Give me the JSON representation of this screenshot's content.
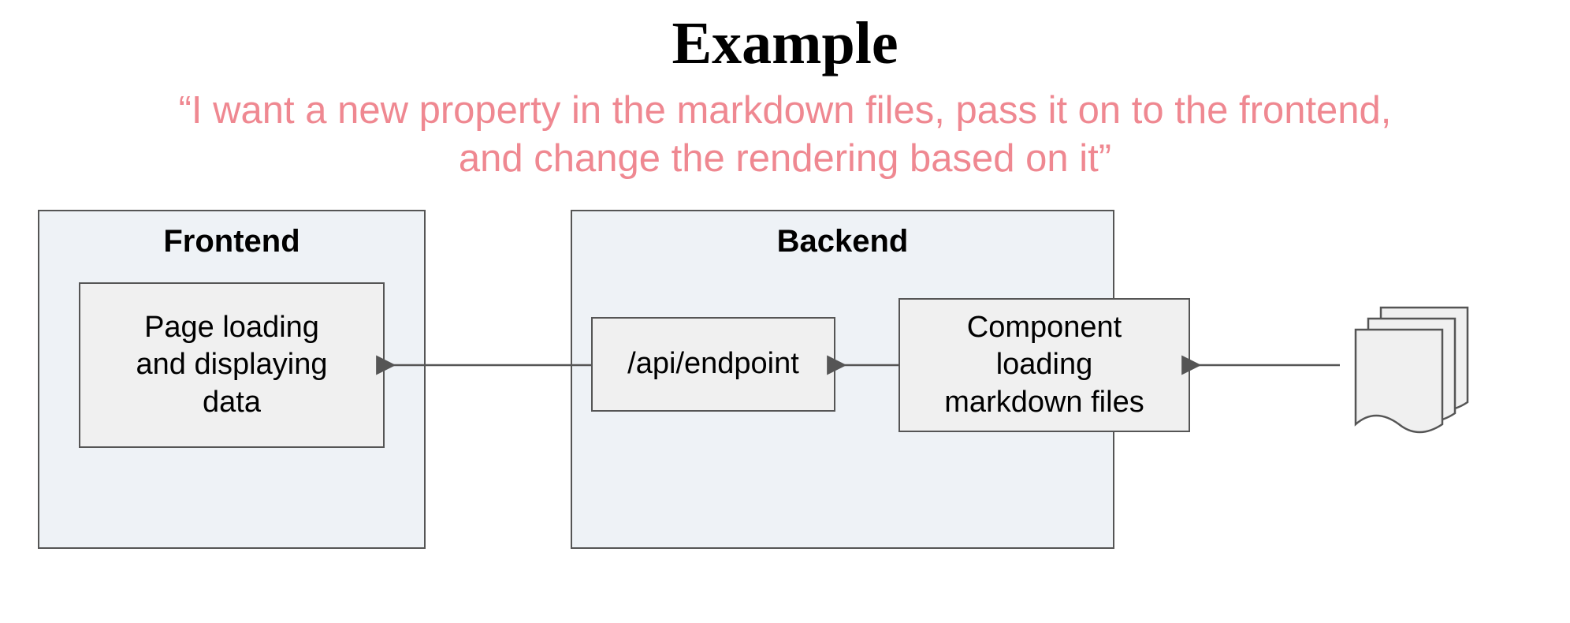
{
  "title": "Example",
  "subtitle_line1": "“I want a new property in the markdown files, pass it on to the frontend,",
  "subtitle_line2": "and change the rendering based on it”",
  "groups": {
    "frontend": {
      "label": "Frontend"
    },
    "backend": {
      "label": "Backend"
    }
  },
  "nodes": {
    "page": {
      "text": "Page loading\nand displaying\ndata"
    },
    "api": {
      "text": "/api/endpoint"
    },
    "component": {
      "text": "Component\nloading\nmarkdown files"
    }
  }
}
